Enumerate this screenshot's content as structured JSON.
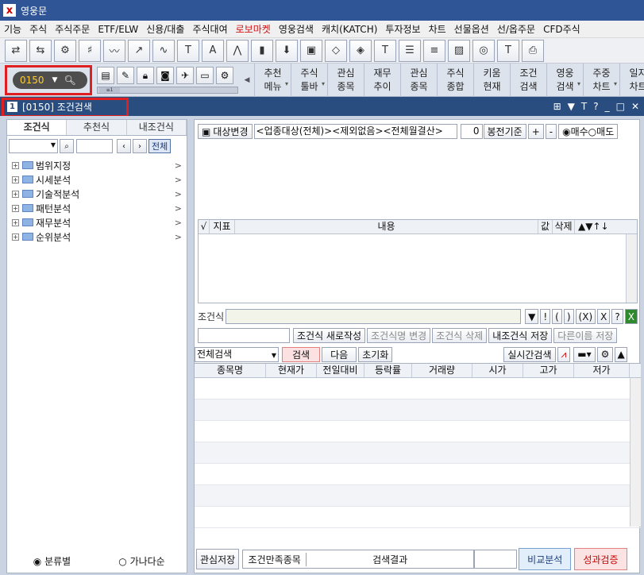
{
  "window": {
    "title": "영웅문"
  },
  "menu": [
    "기능",
    "주식",
    "주식주문",
    "ETF/ELW",
    "신용/대출",
    "주식대여",
    "로보마켓",
    "영웅검색",
    "캐치(KATCH)",
    "투자정보",
    "차트",
    "선물옵션",
    "선/옵주문",
    "CFD주식"
  ],
  "menu_highlight": "로보마켓",
  "toolbar2": {
    "screen_code": "0150",
    "slider_label": "≡1",
    "buttons": [
      {
        "l1": "추천",
        "l2": "메뉴",
        "dropdown": true
      },
      {
        "l1": "주식",
        "l2": "툴바",
        "dropdown": true
      },
      {
        "l1": "관심",
        "l2": "종목",
        "dropdown": false
      },
      {
        "l1": "재무",
        "l2": "추이",
        "dropdown": false
      },
      {
        "l1": "관심",
        "l2": "종목",
        "dropdown": false
      },
      {
        "l1": "주식",
        "l2": "종합",
        "dropdown": false
      },
      {
        "l1": "키움",
        "l2": "현재",
        "dropdown": false
      },
      {
        "l1": "조건",
        "l2": "검색",
        "dropdown": false
      },
      {
        "l1": "영웅",
        "l2": "검색",
        "dropdown": true
      },
      {
        "l1": "주중",
        "l2": "차트",
        "dropdown": true
      },
      {
        "l1": "일지",
        "l2": "차트",
        "dropdown": false
      }
    ]
  },
  "tab": {
    "number": "1",
    "title": "[0150] 조건검색"
  },
  "left": {
    "tabs": [
      "조건식",
      "추천식",
      "내조건식"
    ],
    "active_tab": "조건식",
    "all_label": "전체",
    "tree": [
      "범위지정",
      "시세분석",
      "기술적분석",
      "패턴분석",
      "재무분석",
      "순위분석"
    ],
    "radio1": "분류별",
    "radio2": "가나다순"
  },
  "right": {
    "target_btn": "대상변경",
    "target_text": "<업종대상(전체)><제외없음><전체월결산>",
    "candle_value": "0",
    "candle_label": "봉전기준",
    "plus": "+",
    "minus": "-",
    "buy_label": "매수",
    "sell_label": "매도",
    "cond_headers": [
      "√",
      "지표",
      "내용",
      "값",
      "삭제"
    ],
    "cond_arrows": "▲▼↑↓",
    "formula_label": "조건식",
    "formula_ops": [
      "!",
      "(",
      ")",
      "(X)",
      "X",
      "?"
    ],
    "save_buttons": [
      "조건식 새로작성",
      "조건식명 변경",
      "조건식 삭제",
      "내조건식 저장",
      "다른이름 저장"
    ],
    "search_scope": "전체검색",
    "search_btn": "검색",
    "next_btn": "다음",
    "reset_btn": "초기화",
    "realtime_btn": "실시간검색",
    "result_headers": [
      "종목명",
      "현재가",
      "전일대비",
      "등락률",
      "거래량",
      "시가",
      "고가",
      "저가"
    ],
    "bottom": {
      "interest_save": "관심저장",
      "satisfy_label": "조건만족종목",
      "result_label": "검색결과",
      "compare_btn": "비교분석",
      "perf_btn": "성과검증"
    }
  }
}
